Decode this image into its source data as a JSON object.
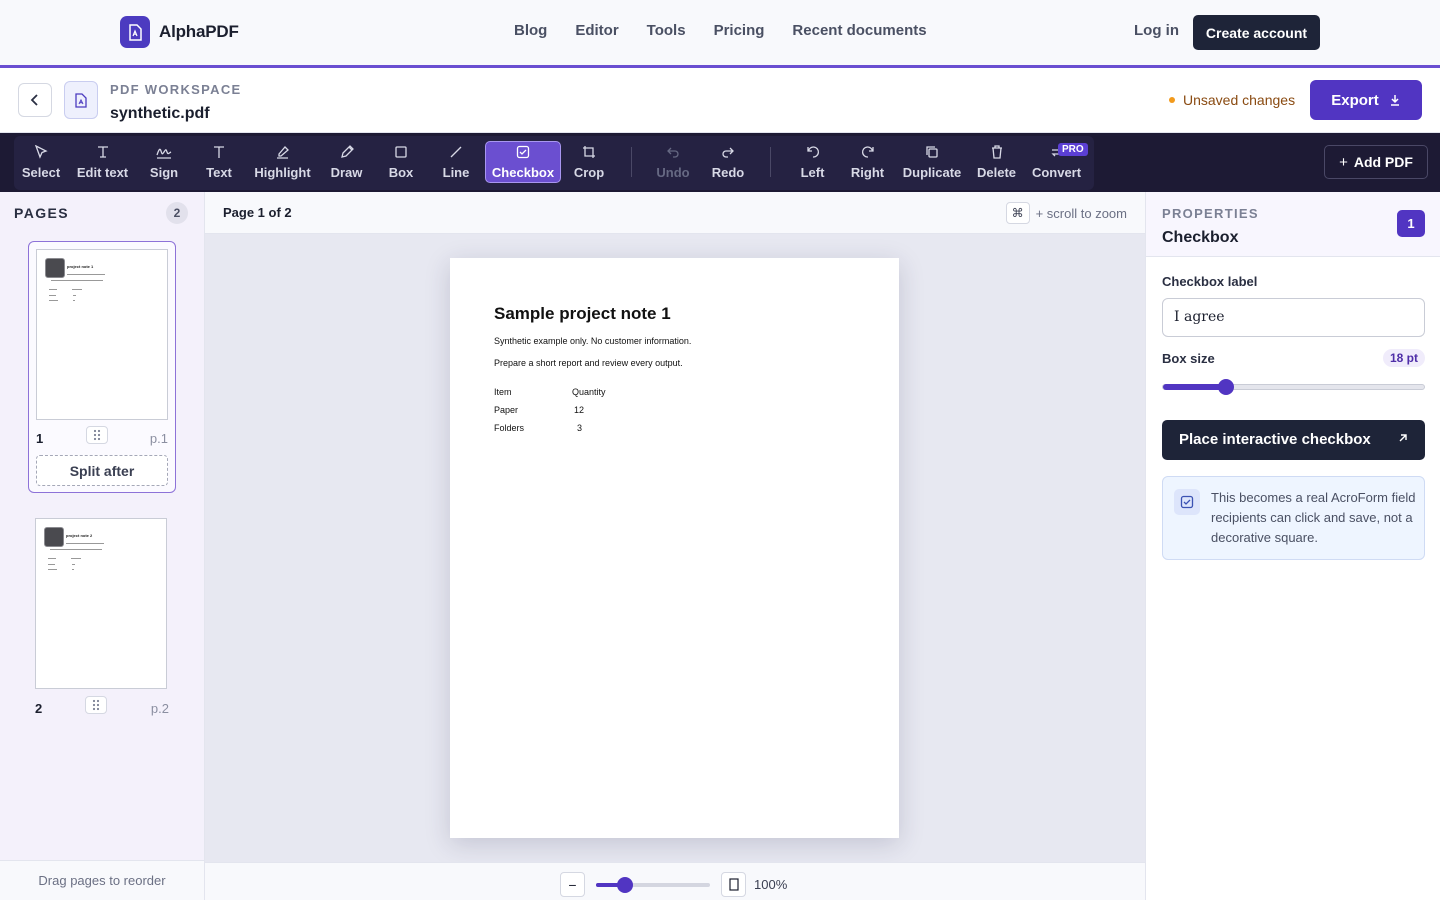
{
  "app": {
    "name": "AlphaPDF"
  },
  "nav": {
    "links": [
      "Blog",
      "Editor",
      "Tools",
      "Pricing",
      "Recent documents"
    ],
    "login": "Log in",
    "create_account": "Create account"
  },
  "workspace": {
    "kicker": "PDF WORKSPACE",
    "filename": "synthetic.pdf",
    "status": "Unsaved changes",
    "export_label": "Export"
  },
  "toolbar": {
    "tools": [
      {
        "label": "Select",
        "icon": "cursor-icon"
      },
      {
        "label": "Edit text",
        "icon": "text-cursor-icon"
      },
      {
        "label": "Sign",
        "icon": "signature-icon"
      },
      {
        "label": "Text",
        "icon": "text-icon"
      },
      {
        "label": "Highlight",
        "icon": "highlighter-icon"
      },
      {
        "label": "Draw",
        "icon": "pencil-icon"
      },
      {
        "label": "Box",
        "icon": "square-icon"
      },
      {
        "label": "Line",
        "icon": "line-icon"
      },
      {
        "label": "Checkbox",
        "icon": "checkbox-icon",
        "active": true
      },
      {
        "label": "Crop",
        "icon": "crop-icon"
      },
      {
        "label": "Undo",
        "icon": "undo-icon",
        "disabled": true
      },
      {
        "label": "Redo",
        "icon": "redo-icon"
      },
      {
        "label": "Left",
        "icon": "rotate-left-icon"
      },
      {
        "label": "Right",
        "icon": "rotate-right-icon"
      },
      {
        "label": "Duplicate",
        "icon": "copy-icon"
      },
      {
        "label": "Delete",
        "icon": "trash-icon"
      },
      {
        "label": "Convert",
        "icon": "convert-icon"
      }
    ],
    "pro_badge": "PRO",
    "add_pdf": "Add PDF"
  },
  "pages": {
    "title": "PAGES",
    "count": "2",
    "items": [
      {
        "number": "1",
        "label": "p.1",
        "thumb_title": "project note 1"
      },
      {
        "number": "2",
        "label": "p.2",
        "thumb_title": "project note 2"
      }
    ],
    "split_after": "Split after",
    "footer": "Drag pages to reorder"
  },
  "canvas": {
    "page_indicator": "Page 1 of 2",
    "zoom_key": "⌘",
    "zoom_hint": "+ scroll to zoom",
    "zoom_level": "100%",
    "zoom_fraction": 0.25
  },
  "document": {
    "title": "Sample project note 1",
    "lines": [
      "Synthetic example only. No customer information.",
      "Prepare a short report and review every output."
    ],
    "table": {
      "headers": [
        "Item",
        "Quantity"
      ],
      "rows": [
        [
          "Paper",
          "12"
        ],
        [
          "Folders",
          "3"
        ]
      ]
    }
  },
  "properties": {
    "kicker": "PROPERTIES",
    "title": "Checkbox",
    "badge": "1",
    "label_field": {
      "label": "Checkbox label",
      "value": "I agree"
    },
    "box_size": {
      "label": "Box size",
      "value": "18 pt",
      "fraction": 0.24
    },
    "place_button": "Place interactive checkbox",
    "info": "This becomes a real AcroForm field recipients can click and save, not a decorative square."
  },
  "colors": {
    "accent": "#5135c2",
    "toolbar_bg": "#1d1a34",
    "status_dot": "#f29a1c"
  }
}
